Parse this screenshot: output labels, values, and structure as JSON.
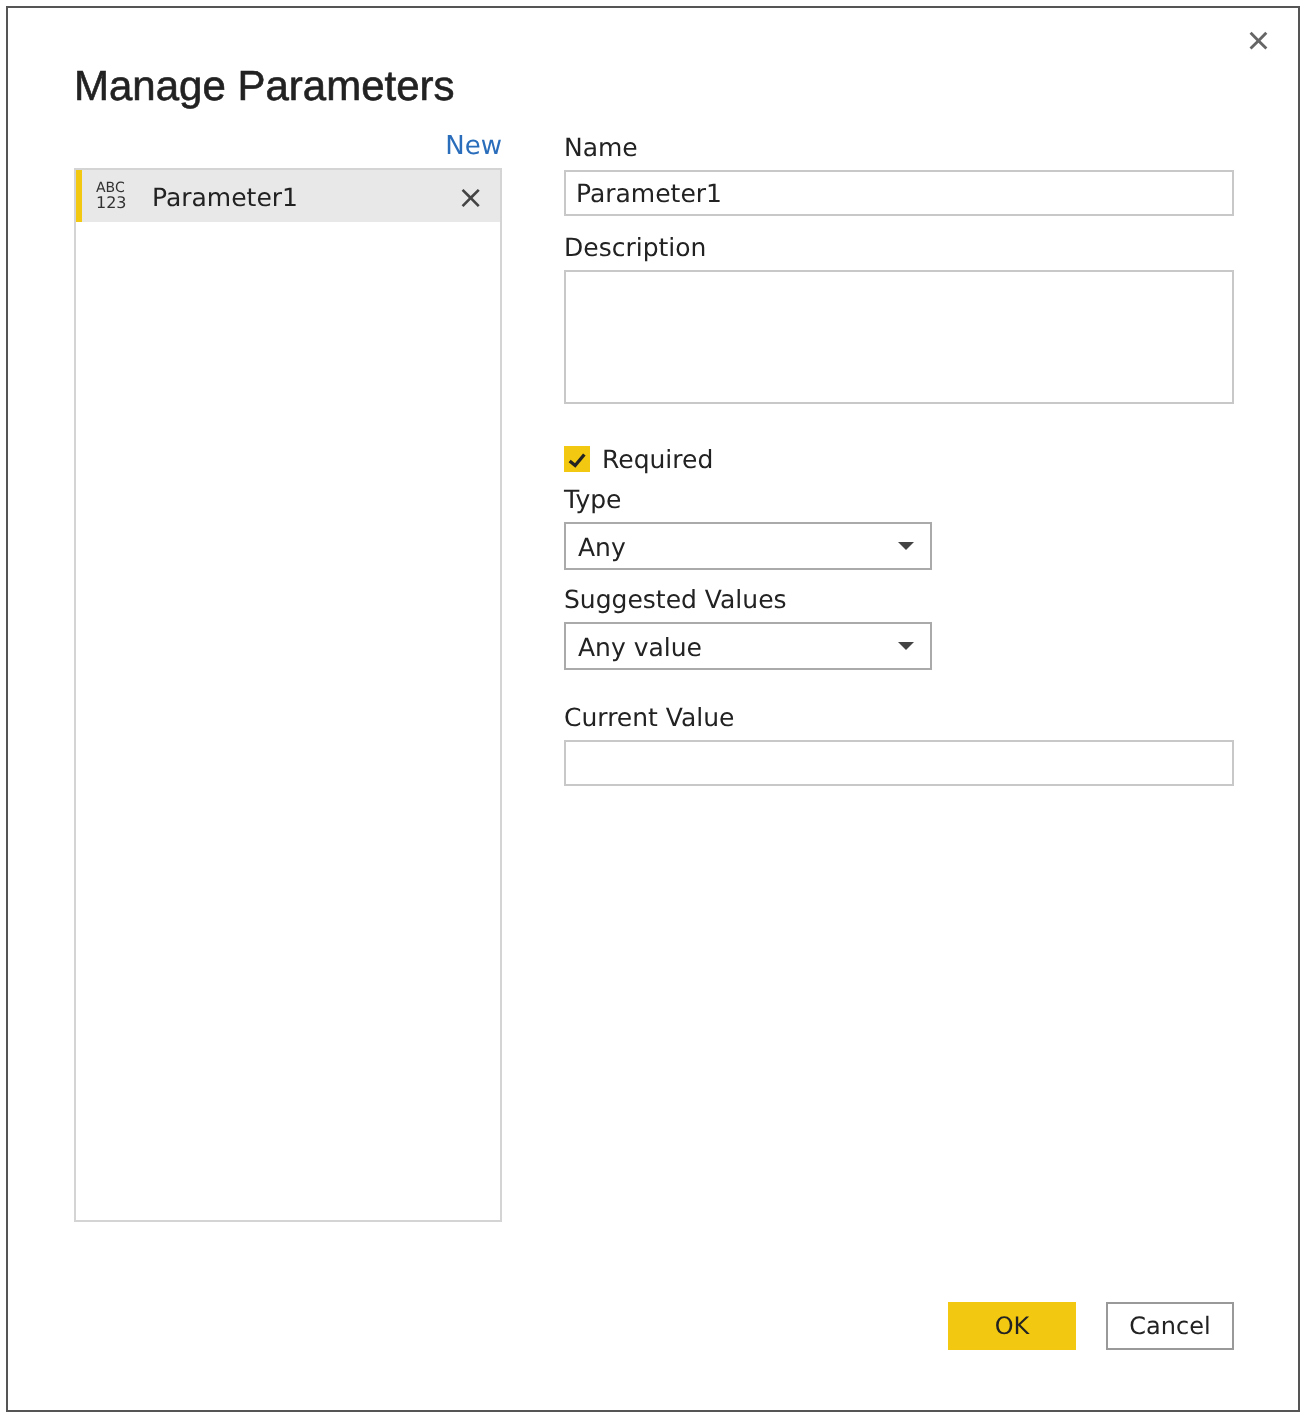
{
  "dialog": {
    "title": "Manage Parameters",
    "close": "×"
  },
  "parameters": {
    "new_link": "New",
    "items": [
      {
        "type_badge": [
          "ABC",
          "123"
        ],
        "name": "Parameter1",
        "remove": "×",
        "selected": true
      }
    ]
  },
  "form": {
    "name": {
      "label": "Name",
      "value": "Parameter1"
    },
    "description": {
      "label": "Description"
    },
    "required": {
      "label": "Required",
      "checked": true
    },
    "type": {
      "label": "Type",
      "value": "Any"
    },
    "suggested_values": {
      "label": "Suggested Values",
      "value": "Any value"
    },
    "current_value": {
      "label": "Current Value"
    }
  },
  "buttons": [
    {
      "label": "OK",
      "kind": "primary"
    },
    {
      "label": "Cancel",
      "kind": "secondary"
    }
  ]
}
